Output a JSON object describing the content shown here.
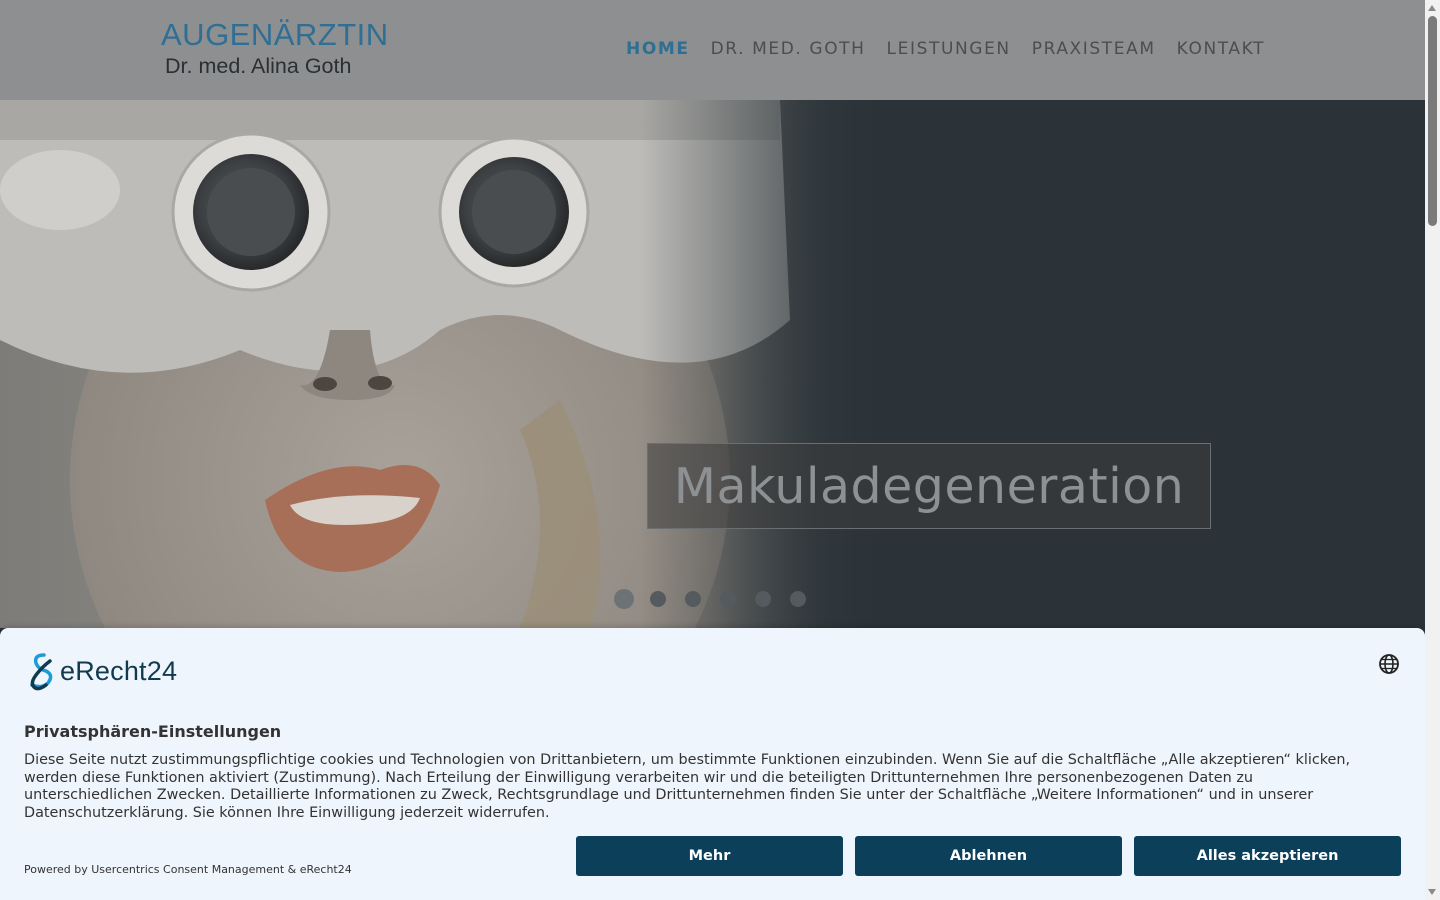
{
  "header": {
    "logo_title": "AUGENÄRZTIN",
    "logo_subtitle": "Dr. med. Alina Goth",
    "nav": [
      {
        "label": "HOME",
        "active": true
      },
      {
        "label": "DR. MED. GOTH",
        "active": false
      },
      {
        "label": "LEISTUNGEN",
        "active": false
      },
      {
        "label": "PRAXISTEAM",
        "active": false
      },
      {
        "label": "KONTAKT",
        "active": false
      }
    ]
  },
  "hero": {
    "caption": "Makuladegeneration",
    "slide_count": 6,
    "active_slide": 1
  },
  "consent": {
    "brand": "eRecht24",
    "title": "Privatsphären-Einstellungen",
    "body": "Diese Seite nutzt zustimmungspflichtige cookies und Technologien von Drittanbietern, um bestimmte Funktionen einzubinden. Wenn Sie auf die Schaltfläche „Alle akzeptieren“ klicken, werden diese Funktionen aktiviert (Zustimmung). Nach Erteilung der Einwilligung verarbeiten wir und die beteiligten Drittunternehmen Ihre personenbezogenen Daten zu unterschiedlichen Zwecken. Detaillierte Informationen zu Zweck, Rechtsgrundlage und Drittunternehmen finden Sie unter der Schaltfläche „Weitere Informationen“ und in unserer Datenschutzerklärung. Sie können Ihre Einwilligung jederzeit widerrufen.",
    "powered_by": "Powered by Usercentrics Consent Management & eRecht24",
    "buttons": {
      "more": "Mehr",
      "decline": "Ablehnen",
      "accept_all": "Alles akzeptieren"
    },
    "language_icon": "globe-icon"
  },
  "colors": {
    "accent": "#2f6f94",
    "button": "#0b3f5a",
    "banner_bg": "#eff5fc"
  }
}
